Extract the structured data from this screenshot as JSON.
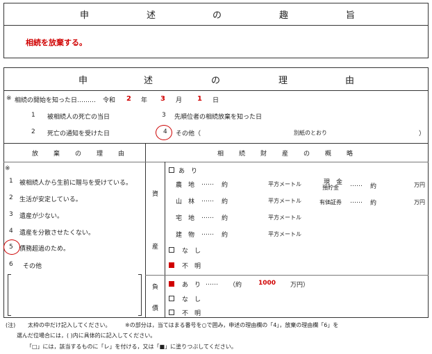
{
  "purpose": {
    "title_chars": [
      "申",
      "述",
      "の",
      "趣",
      "旨"
    ],
    "content": "相続を放棄する。"
  },
  "reasons": {
    "title_chars": [
      "申",
      "述",
      "の",
      "理",
      "由"
    ],
    "start_line": {
      "mark": "※",
      "label": "相続の開始を知った日………",
      "era": "令和",
      "year": "2",
      "year_unit": "年",
      "month": "3",
      "month_unit": "月",
      "day": "1",
      "day_unit": "日"
    },
    "start_options": [
      {
        "num": "1",
        "text": "被相続人の死亡の当日"
      },
      {
        "num": "3",
        "text": "先順位者の相続放棄を知った日"
      },
      {
        "num": "2",
        "text": "死亡の通知を受けた日"
      },
      {
        "num": "4",
        "text": "その他（",
        "detail": "別紙のとおり",
        "close": "）"
      }
    ],
    "selected_start_option": "4"
  },
  "renunciation_reasons": {
    "header_chars": [
      "放",
      "棄",
      "の",
      "理",
      "由"
    ],
    "mark": "※",
    "items": [
      {
        "num": "1",
        "text": "被相続人から生前に贈与を受けている。"
      },
      {
        "num": "2",
        "text": "生活が安定している。"
      },
      {
        "num": "3",
        "text": "遺産が少ない。"
      },
      {
        "num": "4",
        "text": "遺産を分散させたくない。"
      },
      {
        "num": "5",
        "text": "債務超過のため。"
      },
      {
        "num": "6",
        "text": "その他"
      }
    ],
    "selected_item": "5"
  },
  "estate": {
    "header_chars": [
      "相",
      "続",
      "財",
      "産",
      "の",
      "概",
      "略"
    ],
    "assets_label": [
      "資",
      "産"
    ],
    "debts_label": [
      "負",
      "債"
    ],
    "assets_yes": "あ　り",
    "assets_rows": [
      {
        "name": "農　地",
        "dots": "……",
        "unit1": "約",
        "unit2": "平方メートル"
      },
      {
        "name": "山　林",
        "dots": "……",
        "unit1": "約",
        "unit2": "平方メートル"
      },
      {
        "name": "宅　地",
        "dots": "……",
        "unit1": "約",
        "unit2": "平方メートル"
      },
      {
        "name": "建　物",
        "dots": "……",
        "unit1": "約",
        "unit2": "平方メートル"
      }
    ],
    "money_rows": [
      {
        "name1": "現　金",
        "name2": "預貯金",
        "dots": "……",
        "unit1": "約",
        "unit2": "万円"
      },
      {
        "name1": "有価証券",
        "dots": "……",
        "unit1": "約",
        "unit2": "万円"
      }
    ],
    "assets_none": "な　し",
    "assets_unknown": "不　明",
    "assets_unknown_checked": true,
    "debts_yes": "あ　り",
    "debts_dots": "……",
    "debts_approx": "（約",
    "debts_amount": "1000",
    "debts_unit": "万円）",
    "debts_yes_checked": true,
    "debts_none": "な　し",
    "debts_unknown": "不　明"
  },
  "notes": {
    "label": "(注)",
    "line1a": "太枠の中だけ記入してください。",
    "line1b": "※の部分は，当てはまる番号を○で囲み，申述の理由欄の「4」，放棄の理由欄「6」を",
    "line2": "選んだ位場合には，(    )内に具体的に記入してください。",
    "line3": "「□」には，該当するものに「レ」を付ける，又は「■」に塗りつぶしてください。"
  },
  "colors": {
    "accent_red": "#d00000",
    "border": "#333333"
  }
}
